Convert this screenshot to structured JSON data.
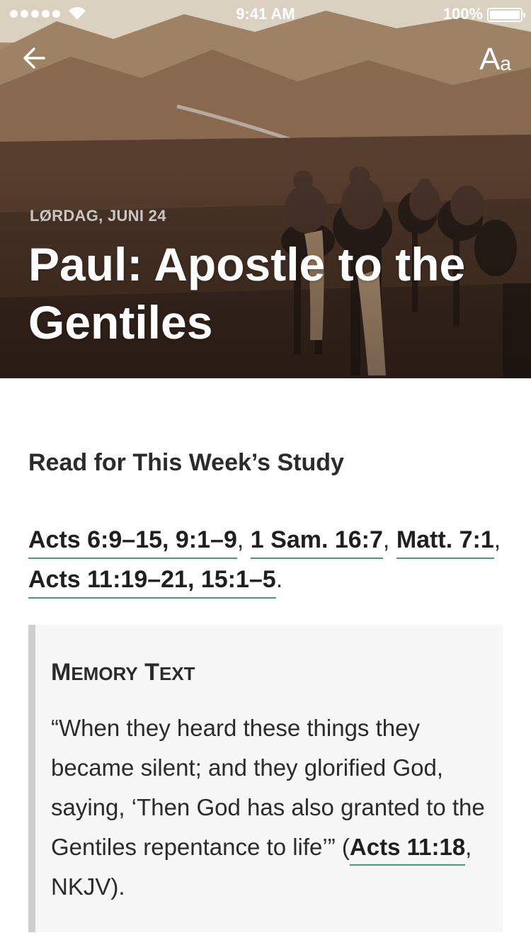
{
  "status_bar": {
    "time": "9:41 AM",
    "battery": "100%"
  },
  "nav": {
    "back_icon": "arrow-left-icon",
    "font_size_big": "A",
    "font_size_small": "a"
  },
  "hero": {
    "date": "LØRDAG, JUNI 24",
    "title": "Paul: Apostle to the Gentiles"
  },
  "study": {
    "heading": "Read for This Week’s Study",
    "readings": [
      {
        "label": "Acts 6:9–15, 9:1–9",
        "sep": ", "
      },
      {
        "label": "1 Sam. 16:7",
        "sep": ", "
      },
      {
        "label": "Matt. 7:1",
        "sep": ", "
      },
      {
        "label": "Acts 11:19–21, 15:1–5",
        "sep": "."
      }
    ]
  },
  "memory": {
    "title_cap1": "M",
    "title_rest1": "EMORY",
    "title_cap2": "T",
    "title_rest2": "EXT",
    "quote": "“When they heard these things they became silent; and they glorified God, saying, ‘Then God has also granted to the Gentiles repentance to life’” (",
    "reference": "Acts 11:18",
    "version": ", NKJV)."
  },
  "colors": {
    "link_underline": "#3aa376",
    "memory_background": "#f7f7f7",
    "memory_border": "#cfcfcf"
  }
}
